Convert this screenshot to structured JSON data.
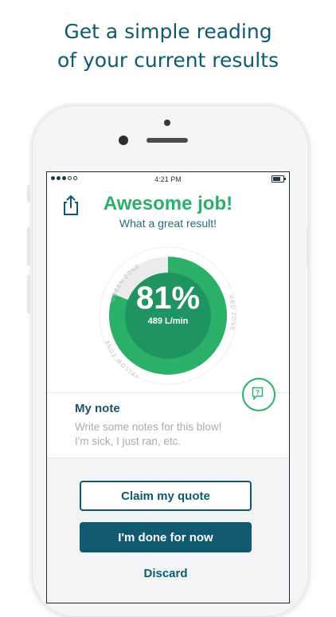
{
  "promo": {
    "headline_line1": "Get a simple reading",
    "headline_line2": "of your current results"
  },
  "statusbar": {
    "time": "4:21 PM",
    "signal_dots_filled": 3,
    "signal_dots_total": 5
  },
  "result": {
    "title": "Awesome job!",
    "subtitle": "What a great result!",
    "percent_label": "81%",
    "percent_value": 81,
    "flow": "489 L/min"
  },
  "gauge": {
    "zones": [
      "GREEN ZONE",
      "RED ZONE",
      "YELLOW ZONE"
    ]
  },
  "note": {
    "title": "My note",
    "placeholder_line1": "Write some notes for this blow!",
    "placeholder_line2": "I'm sick, I just ran, etc."
  },
  "actions": {
    "claim_label": "Claim my quote",
    "done_label": "I'm done for now",
    "discard_label": "Discard"
  },
  "icons": {
    "share": "share-icon",
    "help": "help-icon"
  },
  "colors": {
    "brand": "#0f5a6e",
    "success": "#2bb06a",
    "success_dark": "#1f9460",
    "muted": "#a6acb1"
  }
}
